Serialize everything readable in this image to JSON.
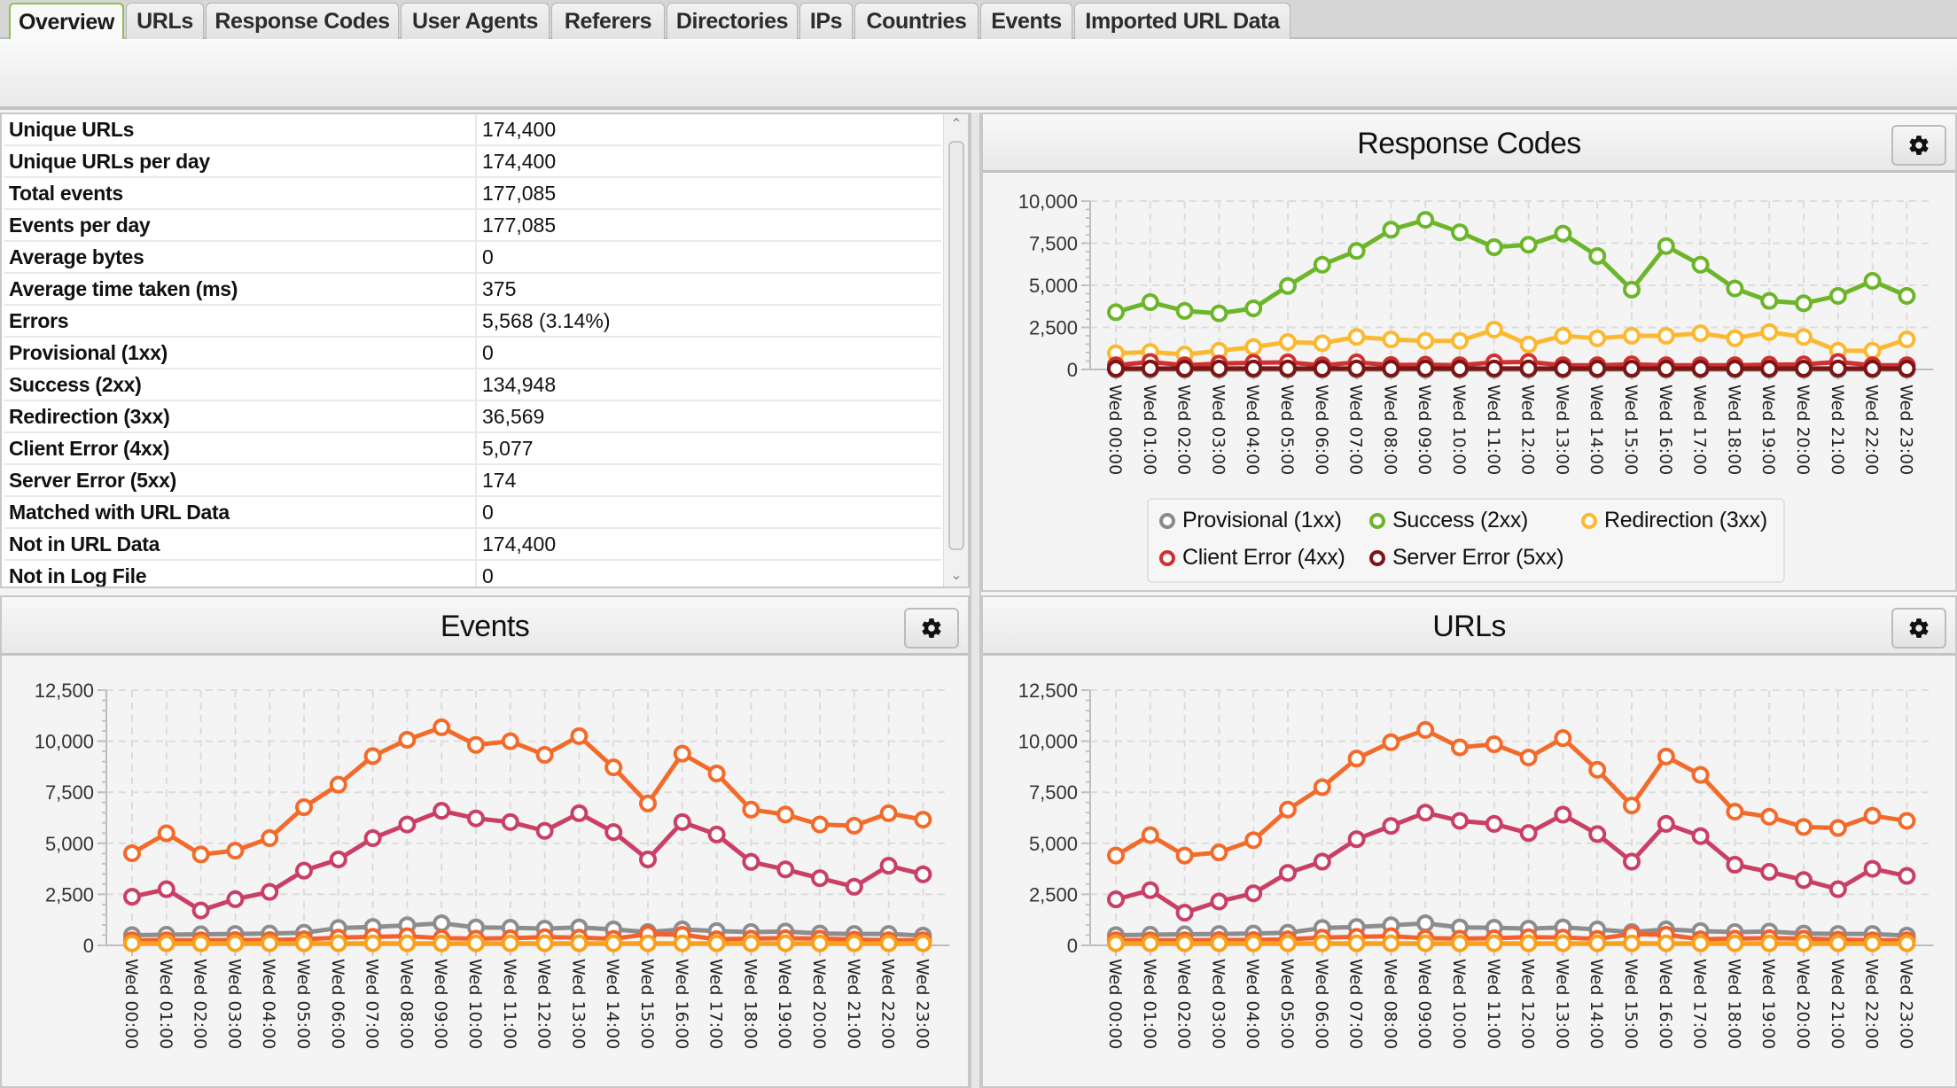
{
  "tabs": [
    {
      "label": "Overview",
      "active": true
    },
    {
      "label": "URLs",
      "active": false
    },
    {
      "label": "Response Codes",
      "active": false
    },
    {
      "label": "User Agents",
      "active": false
    },
    {
      "label": "Referers",
      "active": false
    },
    {
      "label": "Directories",
      "active": false
    },
    {
      "label": "IPs",
      "active": false
    },
    {
      "label": "Countries",
      "active": false
    },
    {
      "label": "Events",
      "active": false
    },
    {
      "label": "Imported URL Data",
      "active": false
    }
  ],
  "overview_table": {
    "rows": [
      {
        "label": "Unique URLs",
        "value": "174,400"
      },
      {
        "label": "Unique URLs per day",
        "value": "174,400"
      },
      {
        "label": "Total events",
        "value": "177,085"
      },
      {
        "label": "Events per day",
        "value": "177,085"
      },
      {
        "label": "Average bytes",
        "value": "0"
      },
      {
        "label": "Average time taken (ms)",
        "value": "375"
      },
      {
        "label": "Errors",
        "value": "5,568 (3.14%)"
      },
      {
        "label": "Provisional (1xx)",
        "value": "0"
      },
      {
        "label": "Success (2xx)",
        "value": "134,948"
      },
      {
        "label": "Redirection (3xx)",
        "value": "36,569"
      },
      {
        "label": "Client Error (4xx)",
        "value": "5,077"
      },
      {
        "label": "Server Error (5xx)",
        "value": "174"
      },
      {
        "label": "Matched with URL Data",
        "value": "0"
      },
      {
        "label": "Not in URL Data",
        "value": "174,400"
      },
      {
        "label": "Not in Log File",
        "value": "0"
      }
    ],
    "scroll_up_icon": "chevron-up-icon",
    "scroll_down_icon": "chevron-down-icon"
  },
  "panels": {
    "response_codes": {
      "title": "Response Codes",
      "settings_icon": "gear-icon"
    },
    "events": {
      "title": "Events",
      "settings_icon": "gear-icon"
    },
    "urls": {
      "title": "URLs",
      "settings_icon": "gear-icon"
    }
  },
  "chart_data": [
    {
      "id": "response_codes",
      "type": "line",
      "title": "Response Codes",
      "xlabel": "",
      "ylabel": "",
      "ylim": [
        0,
        10000
      ],
      "yticks": [
        "0",
        "2,500",
        "5,000",
        "7,500",
        "10,000"
      ],
      "ytick_values": [
        0,
        2500,
        5000,
        7500,
        10000
      ],
      "grid": true,
      "legend": "bottom",
      "categories": [
        "Wed 00:00",
        "Wed 01:00",
        "Wed 02:00",
        "Wed 03:00",
        "Wed 04:00",
        "Wed 05:00",
        "Wed 06:00",
        "Wed 07:00",
        "Wed 08:00",
        "Wed 09:00",
        "Wed 10:00",
        "Wed 11:00",
        "Wed 12:00",
        "Wed 13:00",
        "Wed 14:00",
        "Wed 15:00",
        "Wed 16:00",
        "Wed 17:00",
        "Wed 18:00",
        "Wed 19:00",
        "Wed 20:00",
        "Wed 21:00",
        "Wed 22:00",
        "Wed 23:00"
      ],
      "series": [
        {
          "name": "Provisional (1xx)",
          "color": "#8a8a8a",
          "values": [
            0,
            0,
            0,
            0,
            0,
            0,
            0,
            0,
            0,
            0,
            0,
            0,
            0,
            0,
            0,
            0,
            0,
            0,
            0,
            0,
            0,
            0,
            0,
            0
          ]
        },
        {
          "name": "Success (2xx)",
          "color": "#6db52a",
          "values": [
            3400,
            4000,
            3480,
            3330,
            3630,
            4960,
            6220,
            7040,
            8300,
            8890,
            8150,
            7260,
            7410,
            8070,
            6740,
            4740,
            7330,
            6220,
            4810,
            4070,
            3930,
            4370,
            5260,
            4370
          ]
        },
        {
          "name": "Redirection (3xx)",
          "color": "#fbb931",
          "values": [
            960,
            1040,
            890,
            1110,
            1330,
            1630,
            1560,
            1930,
            1780,
            1700,
            1700,
            2370,
            1480,
            2000,
            1850,
            2000,
            2000,
            2150,
            1850,
            2220,
            1930,
            1110,
            1110,
            1780
          ]
        },
        {
          "name": "Client Error (4xx)",
          "color": "#d0302f",
          "values": [
            250,
            450,
            250,
            350,
            400,
            420,
            250,
            420,
            260,
            280,
            250,
            420,
            450,
            250,
            250,
            300,
            250,
            250,
            250,
            280,
            300,
            450,
            250,
            250
          ]
        },
        {
          "name": "Server Error (5xx)",
          "color": "#7d1515",
          "values": [
            50,
            60,
            50,
            60,
            60,
            60,
            50,
            60,
            50,
            60,
            50,
            60,
            60,
            50,
            50,
            50,
            50,
            50,
            50,
            50,
            50,
            60,
            50,
            50
          ]
        }
      ]
    },
    {
      "id": "events",
      "type": "line",
      "title": "Events",
      "xlabel": "",
      "ylabel": "",
      "ylim": [
        0,
        12500
      ],
      "yticks": [
        "0",
        "2,500",
        "5,000",
        "7,500",
        "10,000",
        "12,500"
      ],
      "ytick_values": [
        0,
        2500,
        5000,
        7500,
        10000,
        12500
      ],
      "grid": true,
      "legend": "none",
      "categories": [
        "Wed 00:00",
        "Wed 01:00",
        "Wed 02:00",
        "Wed 03:00",
        "Wed 04:00",
        "Wed 05:00",
        "Wed 06:00",
        "Wed 07:00",
        "Wed 08:00",
        "Wed 09:00",
        "Wed 10:00",
        "Wed 11:00",
        "Wed 12:00",
        "Wed 13:00",
        "Wed 14:00",
        "Wed 15:00",
        "Wed 16:00",
        "Wed 17:00",
        "Wed 18:00",
        "Wed 19:00",
        "Wed 20:00",
        "Wed 21:00",
        "Wed 22:00",
        "Wed 23:00"
      ],
      "series": [
        {
          "name": "",
          "color": "#f26b2b",
          "values": [
            4510,
            5490,
            4450,
            4640,
            5250,
            6770,
            7870,
            9270,
            10070,
            10680,
            9820,
            10000,
            9330,
            10250,
            8720,
            6950,
            9390,
            8420,
            6650,
            6410,
            5920,
            5860,
            6470,
            6160
          ]
        },
        {
          "name": "",
          "color": "#c93f65",
          "values": [
            2380,
            2750,
            1710,
            2260,
            2620,
            3660,
            4210,
            5250,
            5920,
            6590,
            6220,
            6040,
            5610,
            6470,
            5550,
            4210,
            6040,
            5430,
            4090,
            3720,
            3290,
            2870,
            3900,
            3480
          ]
        },
        {
          "name": "",
          "color": "#8d8d8d",
          "values": [
            500,
            520,
            540,
            560,
            580,
            620,
            850,
            900,
            980,
            1080,
            880,
            860,
            820,
            880,
            780,
            650,
            780,
            700,
            650,
            680,
            580,
            560,
            560,
            480
          ]
        },
        {
          "name": "",
          "color": "#f2622c",
          "values": [
            250,
            250,
            250,
            260,
            260,
            300,
            380,
            420,
            450,
            350,
            330,
            350,
            400,
            380,
            320,
            550,
            520,
            300,
            330,
            350,
            330,
            280,
            250,
            250
          ]
        },
        {
          "name": "",
          "color": "#f9a11b",
          "values": [
            100,
            100,
            100,
            100,
            100,
            100,
            100,
            100,
            100,
            100,
            100,
            100,
            100,
            100,
            100,
            100,
            100,
            100,
            100,
            100,
            100,
            100,
            100,
            100
          ]
        }
      ]
    },
    {
      "id": "urls",
      "type": "line",
      "title": "URLs",
      "xlabel": "",
      "ylabel": "",
      "ylim": [
        0,
        12500
      ],
      "yticks": [
        "0",
        "2,500",
        "5,000",
        "7,500",
        "10,000",
        "12,500"
      ],
      "ytick_values": [
        0,
        2500,
        5000,
        7500,
        10000,
        12500
      ],
      "grid": true,
      "legend": "none",
      "categories": [
        "Wed 00:00",
        "Wed 01:00",
        "Wed 02:00",
        "Wed 03:00",
        "Wed 04:00",
        "Wed 05:00",
        "Wed 06:00",
        "Wed 07:00",
        "Wed 08:00",
        "Wed 09:00",
        "Wed 10:00",
        "Wed 11:00",
        "Wed 12:00",
        "Wed 13:00",
        "Wed 14:00",
        "Wed 15:00",
        "Wed 16:00",
        "Wed 17:00",
        "Wed 18:00",
        "Wed 19:00",
        "Wed 20:00",
        "Wed 21:00",
        "Wed 22:00",
        "Wed 23:00"
      ],
      "series": [
        {
          "name": "",
          "color": "#f26b2b",
          "values": [
            4400,
            5400,
            4400,
            4550,
            5150,
            6650,
            7750,
            9150,
            9950,
            10550,
            9700,
            9850,
            9200,
            10150,
            8600,
            6850,
            9250,
            8350,
            6550,
            6300,
            5800,
            5750,
            6350,
            6100
          ]
        },
        {
          "name": "",
          "color": "#c93f65",
          "values": [
            2250,
            2700,
            1600,
            2150,
            2550,
            3550,
            4100,
            5200,
            5850,
            6500,
            6100,
            5950,
            5500,
            6400,
            5450,
            4100,
            5950,
            5350,
            3950,
            3600,
            3200,
            2750,
            3750,
            3400
          ]
        },
        {
          "name": "",
          "color": "#8d8d8d",
          "values": [
            500,
            520,
            540,
            560,
            580,
            620,
            850,
            900,
            980,
            1080,
            880,
            860,
            820,
            880,
            780,
            650,
            780,
            700,
            650,
            680,
            580,
            560,
            560,
            480
          ]
        },
        {
          "name": "",
          "color": "#f2622c",
          "values": [
            250,
            250,
            250,
            260,
            260,
            300,
            380,
            420,
            450,
            350,
            330,
            350,
            400,
            380,
            320,
            550,
            520,
            300,
            330,
            350,
            330,
            280,
            250,
            250
          ]
        },
        {
          "name": "",
          "color": "#f9a11b",
          "values": [
            100,
            100,
            100,
            100,
            100,
            100,
            100,
            100,
            100,
            100,
            100,
            100,
            100,
            100,
            100,
            100,
            100,
            100,
            100,
            100,
            100,
            100,
            100,
            100
          ]
        }
      ]
    }
  ]
}
